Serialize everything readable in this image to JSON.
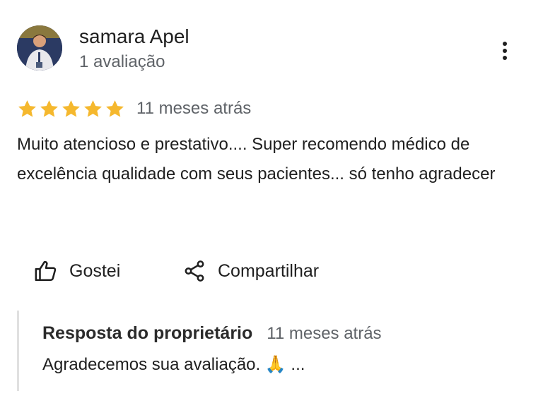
{
  "review": {
    "reviewer_name": "samara Apel",
    "reviewer_count": "1 avaliação",
    "rating": 5,
    "rating_max": 5,
    "star_color": "#f5b82e",
    "time": "11 meses atrás",
    "text": "Muito atencioso e prestativo.... Super recomendo médico de excelência qualidade com seus pacientes... só tenho agradecer"
  },
  "actions": {
    "like_label": "Gostei",
    "share_label": "Compartilhar"
  },
  "owner_reply": {
    "title": "Resposta do proprietário",
    "time": "11 meses atrás",
    "text": "Agradecemos sua avaliação. 🙏 ..."
  },
  "icons": {
    "menu": "more-vert-icon",
    "like": "thumb-up-icon",
    "share": "share-icon"
  }
}
